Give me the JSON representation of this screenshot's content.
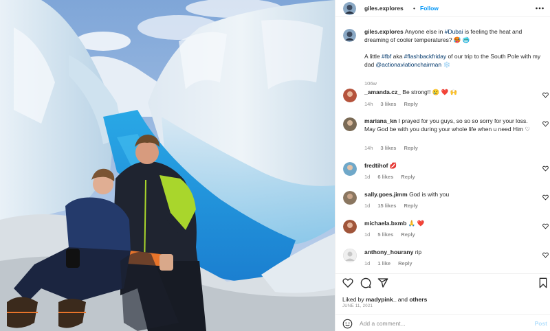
{
  "post": {
    "username": "giles.explores",
    "dot": "•",
    "follow_label": "Follow",
    "caption": {
      "username": "giles.explores",
      "part1": " Anyone else in ",
      "tag_dubai": "#Dubai",
      "part2": " is feeling the heat and dreaming of cooler temperatures? 🥵 🥶",
      "part3": "A little ",
      "tag_fbf": "#fbf",
      "part4": " aka ",
      "tag_flashback": "#flashbackfriday",
      "part5": " of our trip to the South Pole with my dad ",
      "mention": "@actionaviationchairman",
      "part6": " ❄️"
    },
    "caption_time": "106w"
  },
  "comments": [
    {
      "username": "_amanda.cz_",
      "text": "Be strong!! 😢 ❤️ 🙌",
      "time": "14h",
      "likes": "3 likes",
      "reply": "Reply",
      "avatar": "#b5533c"
    },
    {
      "username": "mariana_kn",
      "text": "I prayed for you guys, so so so sorry for your loss. May God be with you during your whole life when u need Him ♡",
      "time": "14h",
      "likes": "3 likes",
      "reply": "Reply",
      "avatar": "#7a6a55"
    },
    {
      "username": "fredtihof",
      "text": "💋",
      "time": "1d",
      "likes": "6 likes",
      "reply": "Reply",
      "avatar": "#6fa8c9"
    },
    {
      "username": "sally.goes.jimm",
      "text": "God is with you",
      "time": "1d",
      "likes": "15 likes",
      "reply": "Reply",
      "avatar": "#8a7660"
    },
    {
      "username": "michaela.bxmb",
      "text": "🙏 ❤️",
      "time": "1d",
      "likes": "5 likes",
      "reply": "Reply",
      "avatar": "#a0553a"
    },
    {
      "username": "anthony_hourany",
      "text": "rip",
      "time": "1d",
      "likes": "1 like",
      "reply": "Reply",
      "avatar": "#dbdbdb"
    }
  ],
  "liked_by": {
    "prefix": "Liked by ",
    "user": "madypink_",
    "and": " and ",
    "others": "others"
  },
  "date": "JUNE 11, 2021",
  "comment_box": {
    "placeholder": "Add a comment...",
    "post_label": "Post"
  }
}
